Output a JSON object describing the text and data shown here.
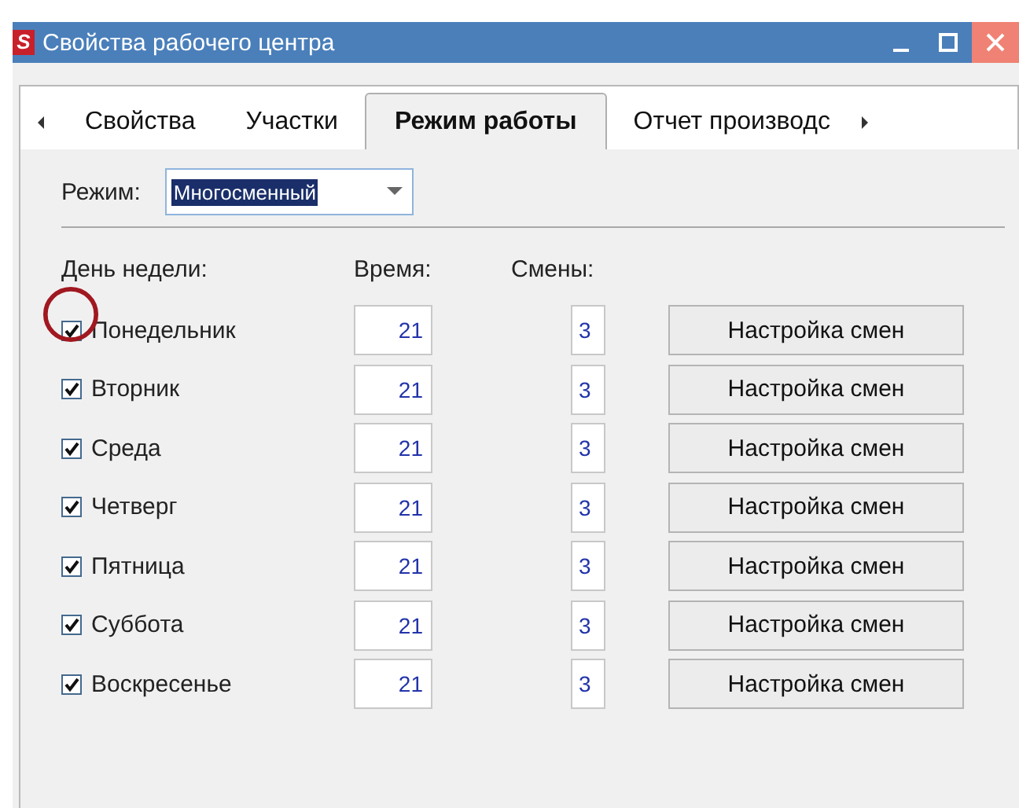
{
  "window": {
    "icon_text": "S",
    "title": "Свойства рабочего центра"
  },
  "tabs": [
    {
      "label": "Свойства",
      "selected": false
    },
    {
      "label": "Участки",
      "selected": false
    },
    {
      "label": "Режим работы",
      "selected": true
    },
    {
      "label": "Отчет производс",
      "selected": false
    }
  ],
  "mode": {
    "label": "Режим:",
    "value": "Многосменный"
  },
  "columns": {
    "day": "День недели:",
    "time": "Время:",
    "shifts": "Смены:"
  },
  "days": [
    {
      "name": "Понедельник",
      "checked": true,
      "time": "21",
      "shifts": "3",
      "button": "Настройка смен"
    },
    {
      "name": "Вторник",
      "checked": true,
      "time": "21",
      "shifts": "3",
      "button": "Настройка смен"
    },
    {
      "name": "Среда",
      "checked": true,
      "time": "21",
      "shifts": "3",
      "button": "Настройка смен"
    },
    {
      "name": "Четверг",
      "checked": true,
      "time": "21",
      "shifts": "3",
      "button": "Настройка смен"
    },
    {
      "name": "Пятница",
      "checked": true,
      "time": "21",
      "shifts": "3",
      "button": "Настройка смен"
    },
    {
      "name": "Суббота",
      "checked": true,
      "time": "21",
      "shifts": "3",
      "button": "Настройка смен"
    },
    {
      "name": "Воскресенье",
      "checked": true,
      "time": "21",
      "shifts": "3",
      "button": "Настройка смен"
    }
  ]
}
